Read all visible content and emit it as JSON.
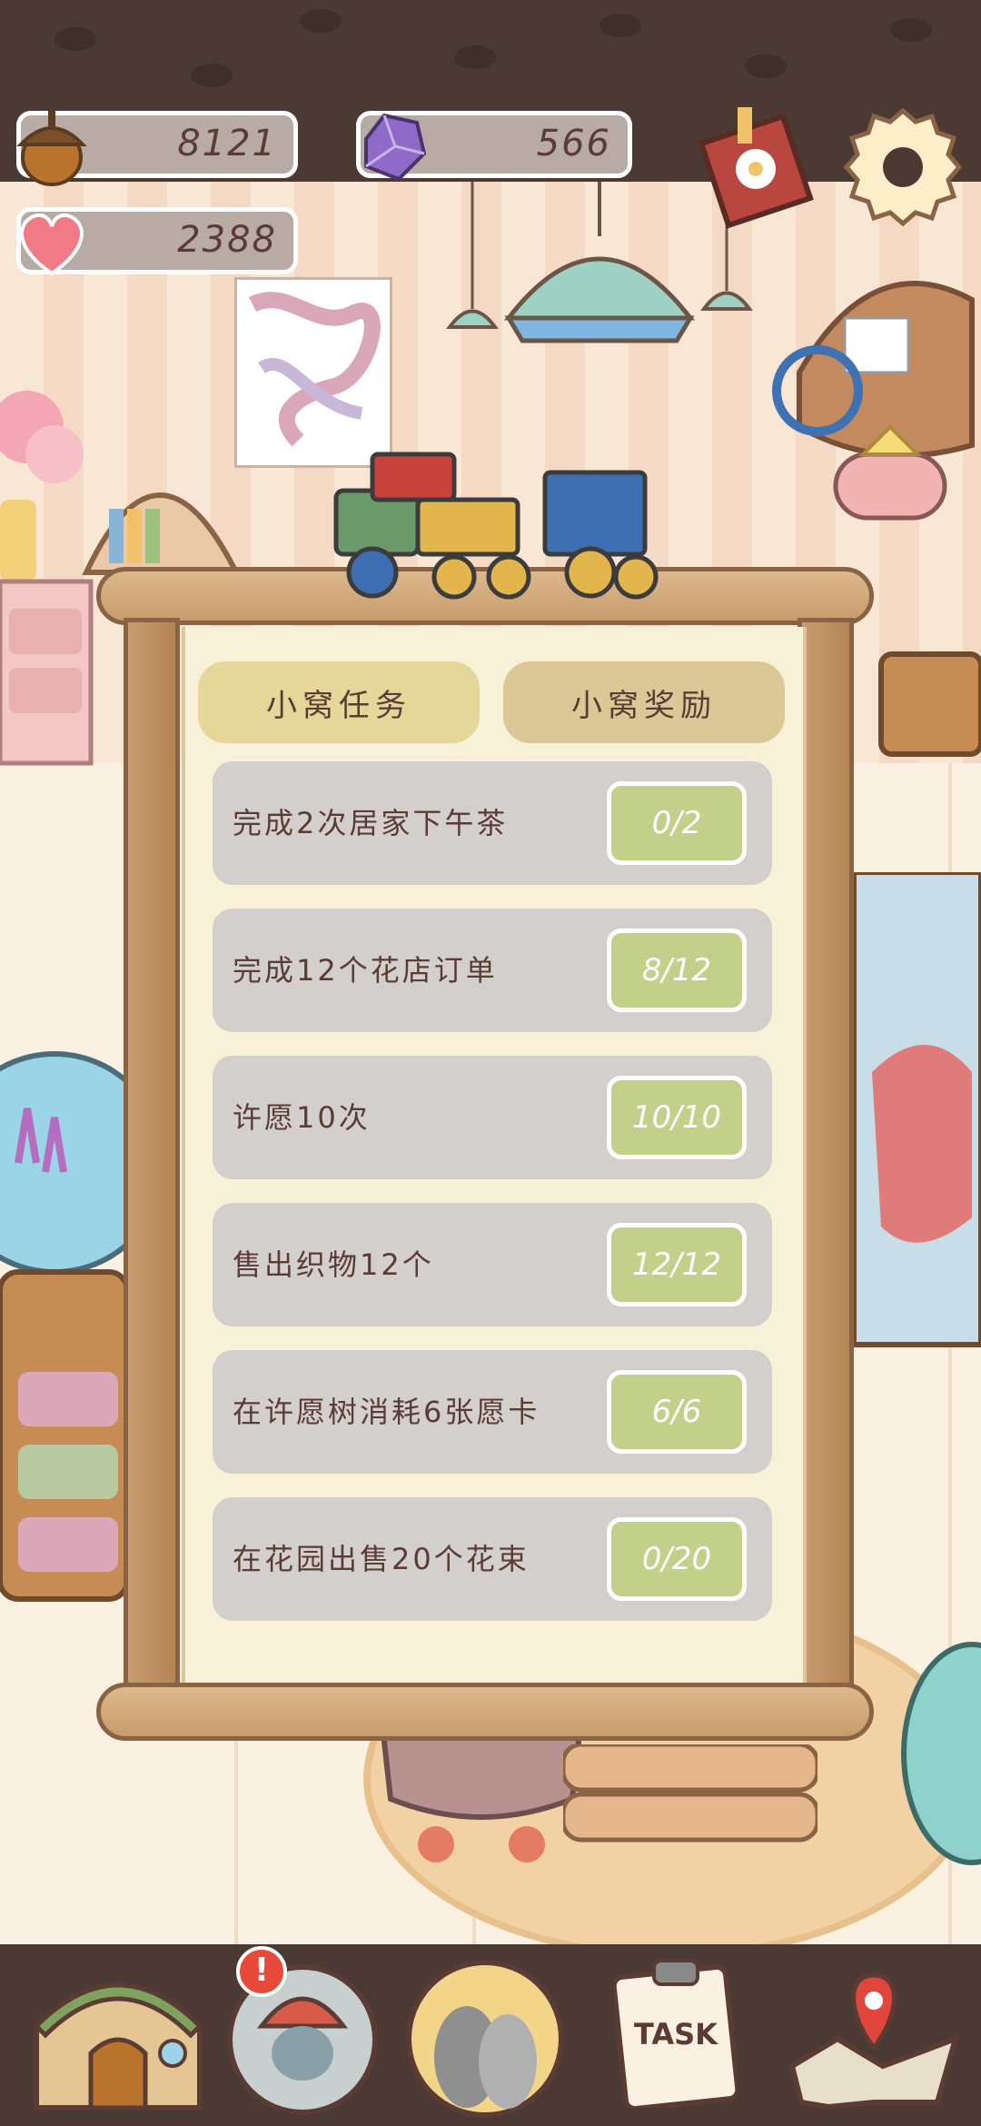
{
  "resources": {
    "acorn": "8121",
    "gem": "566",
    "heart": "2388"
  },
  "icons": {
    "acorn": "acorn-icon",
    "gem": "purple-gem-icon",
    "heart": "heart-icon",
    "book": "flower-book-icon",
    "settings": "gear-icon"
  },
  "panel": {
    "tabs": [
      {
        "label": "小窝任务",
        "active": true
      },
      {
        "label": "小窝奖励",
        "active": false
      }
    ],
    "tasks": [
      {
        "label": "完成2次居家下午茶",
        "progress": "0/2"
      },
      {
        "label": "完成12个花店订单",
        "progress": "8/12"
      },
      {
        "label": "许愿10次",
        "progress": "10/10"
      },
      {
        "label": "售出织物12个",
        "progress": "12/12"
      },
      {
        "label": "在许愿树消耗6张愿卡",
        "progress": "6/6"
      },
      {
        "label": "在花园出售20个花束",
        "progress": "0/20"
      }
    ]
  },
  "nav": {
    "task_label": "TASK",
    "alert_mark": "!"
  },
  "colors": {
    "progress_green": "#c2d08a",
    "panel_paper": "#f7f1d7",
    "wood": "#c89d6e",
    "dark_band": "#4a3a33"
  }
}
